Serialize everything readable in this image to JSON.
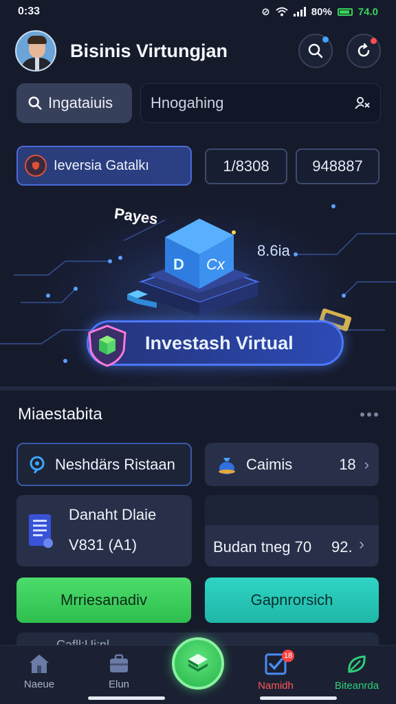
{
  "status_bar": {
    "time": "0:33",
    "battery_percent": "80%",
    "battery_value": "74.0"
  },
  "header": {
    "title": "Bisinis Virtungjan"
  },
  "search": {
    "chip_label": "Ingataiuis",
    "input_placeholder": "Hnogahing"
  },
  "stats": {
    "main_label": "Ieversia Gatalkı",
    "box1_value": "1/8308",
    "box2_value": "948887"
  },
  "hero": {
    "label_left": "Payes",
    "label_right": "8.6ia",
    "cube_letters": [
      "D",
      "Cx"
    ],
    "banner_label": "Investash Virtual"
  },
  "section": {
    "title": "Miaestabita"
  },
  "cards": {
    "network_label": "Neshdärs Ristaan",
    "claims_label": "Caimis",
    "claims_value": "18",
    "doc_title": "Danaht Dlaie",
    "doc_sub": "V831 (A1)",
    "budget_label": "Budan tneg 70",
    "budget_value": "92."
  },
  "actions": {
    "primary_label": "Mrriesanadiv",
    "secondary_label": "Gapnrorsich"
  },
  "peek_text": "Cafll:Ui:nl",
  "nav": {
    "items": [
      {
        "label": "Naeue",
        "icon": "home-icon"
      },
      {
        "label": "Elun",
        "icon": "briefcase-icon"
      },
      {
        "label": "Namidh",
        "icon": "checklist-icon",
        "badge": "18"
      },
      {
        "label": "Biteanrda",
        "icon": "leaf-icon"
      }
    ]
  },
  "colors": {
    "accent_blue": "#4d78ff",
    "accent_green": "#37d35a",
    "accent_teal": "#1fb7a8",
    "alert_red": "#ff4242"
  }
}
